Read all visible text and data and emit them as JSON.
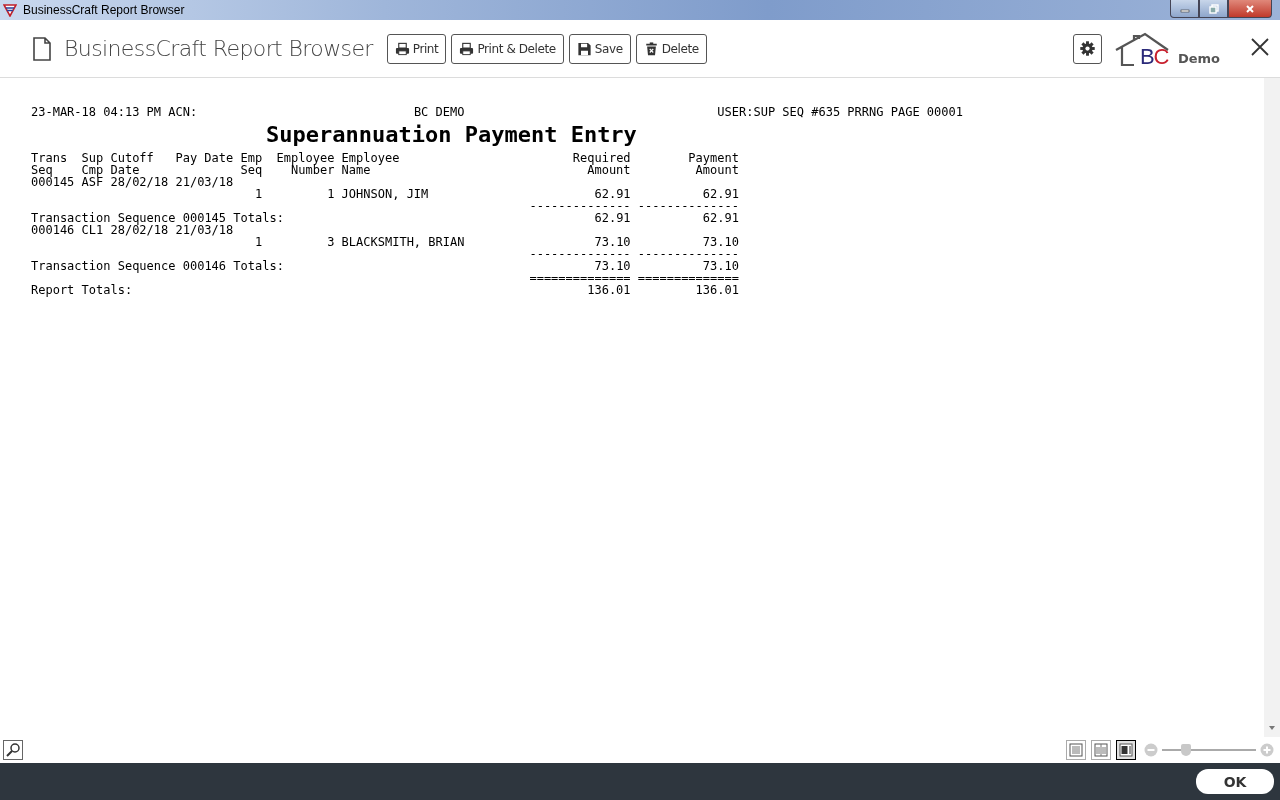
{
  "window": {
    "title": "BusinessCraft Report Browser"
  },
  "toolbar": {
    "title": "BusinessCraft Report Browser",
    "buttons": [
      {
        "kind": "print",
        "label": "Print"
      },
      {
        "kind": "print",
        "label": "Print & Delete"
      },
      {
        "kind": "save",
        "label": "Save"
      },
      {
        "kind": "delete",
        "label": "Delete"
      }
    ],
    "brand": {
      "logo": "BC",
      "subtitle": "Demo"
    }
  },
  "report": {
    "header": [
      "23-MAR-18 04:13 PM ACN:",
      "BC DEMO",
      "USER:SUP SEQ #635 PRRNG PAGE 00001"
    ],
    "title": "Superannuation Payment Entry",
    "columns": [
      {
        "heading": [
          "Trans",
          "Seq"
        ]
      },
      {
        "heading": [
          "Sup",
          "Cmp"
        ]
      },
      {
        "heading": [
          "Cutoff",
          "Date"
        ]
      },
      {
        "heading": [
          "Pay Date"
        ]
      },
      {
        "heading": [
          "Emp",
          "Seq"
        ]
      },
      {
        "heading": [
          "Employee",
          "Number"
        ]
      },
      {
        "heading": [
          "Employee",
          "Name"
        ]
      },
      {
        "heading": [
          "Required",
          "Amount"
        ]
      },
      {
        "heading": [
          "Payment",
          "Amount"
        ]
      }
    ],
    "rows": [
      {
        "kind": "transaction",
        "trans_seq": "000145",
        "sup_cmp": "ASF",
        "cutoff_date": "28/02/18",
        "pay_date": "21/03/18"
      },
      {
        "kind": "employee",
        "emp_seq": "1",
        "employee_number": "1",
        "employee_name": "JOHNSON, JIM",
        "required_amount": "62.91",
        "payment_amount": "62.91"
      },
      {
        "kind": "rule",
        "required_amount": "--------------",
        "payment_amount": "--------------"
      },
      {
        "kind": "total",
        "label": "Transaction Sequence 000145 Totals:",
        "required_amount": "62.91",
        "payment_amount": "62.91"
      },
      {
        "kind": "transaction",
        "trans_seq": "000146",
        "sup_cmp": "CL1",
        "cutoff_date": "28/02/18",
        "pay_date": "21/03/18"
      },
      {
        "kind": "employee",
        "emp_seq": "1",
        "employee_number": "3",
        "employee_name": "BLACKSMITH, BRIAN",
        "required_amount": "73.10",
        "payment_amount": "73.10"
      },
      {
        "kind": "rule",
        "required_amount": "--------------",
        "payment_amount": "--------------"
      },
      {
        "kind": "total",
        "label": "Transaction Sequence 000146 Totals:",
        "required_amount": "73.10",
        "payment_amount": "73.10"
      },
      {
        "kind": "rule",
        "required_amount": "==============",
        "payment_amount": "=============="
      },
      {
        "kind": "total",
        "label": "Report Totals:",
        "required_amount": "136.01",
        "payment_amount": "136.01"
      }
    ]
  },
  "bottom_bar": {
    "view_modes": [
      {
        "kind": "single",
        "selected": false
      },
      {
        "kind": "double",
        "selected": false
      },
      {
        "kind": "outline",
        "selected": true
      }
    ],
    "zoom": {
      "level": 0.25
    }
  },
  "footer": {
    "ok_button": "OK"
  }
}
